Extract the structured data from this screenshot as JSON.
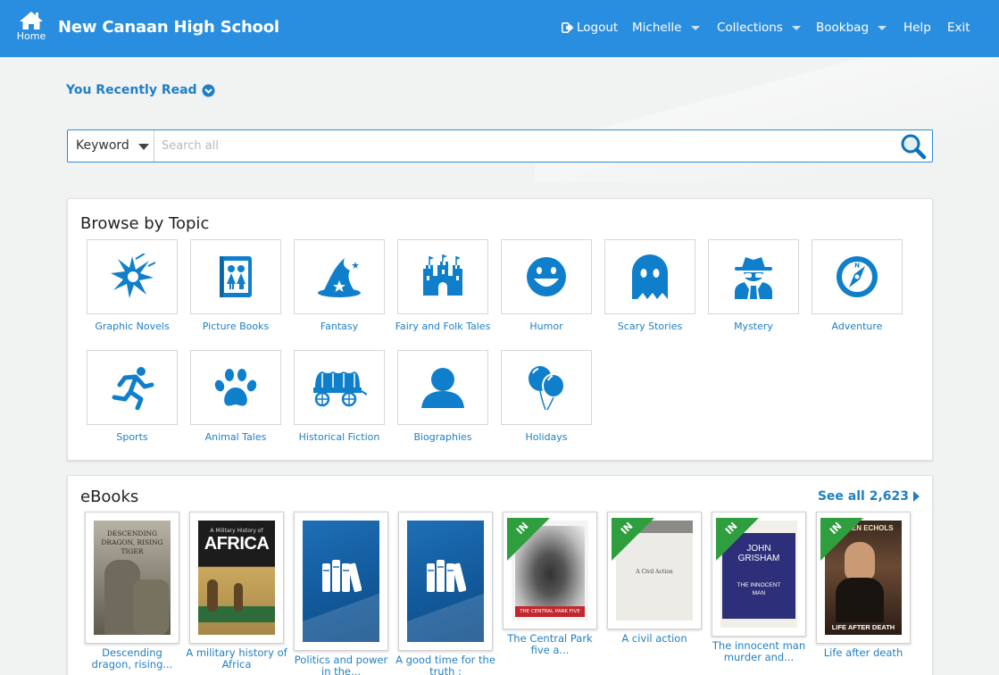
{
  "header": {
    "home_label": "Home",
    "school_name": "New Canaan High School",
    "logout": "Logout",
    "user": "Michelle",
    "collections": "Collections",
    "bookbag": "Bookbag",
    "help": "Help",
    "exit": "Exit"
  },
  "recent": {
    "label": "You Recently Read"
  },
  "search": {
    "type": "Keyword",
    "placeholder": "Search all"
  },
  "browse": {
    "title": "Browse by Topic",
    "topics": [
      {
        "label": "Graphic Novels",
        "icon": "burst-icon"
      },
      {
        "label": "Picture Books",
        "icon": "picture-book-icon"
      },
      {
        "label": "Fantasy",
        "icon": "wizard-hat-icon"
      },
      {
        "label": "Fairy and Folk Tales",
        "icon": "castle-icon"
      },
      {
        "label": "Humor",
        "icon": "smiley-icon"
      },
      {
        "label": "Scary Stories",
        "icon": "ghost-icon"
      },
      {
        "label": "Mystery",
        "icon": "detective-icon"
      },
      {
        "label": "Adventure",
        "icon": "compass-icon"
      },
      {
        "label": "Sports",
        "icon": "runner-icon"
      },
      {
        "label": "Animal Tales",
        "icon": "paw-icon"
      },
      {
        "label": "Historical Fiction",
        "icon": "covered-wagon-icon"
      },
      {
        "label": "Biographies",
        "icon": "person-icon"
      },
      {
        "label": "Holidays",
        "icon": "balloons-icon"
      }
    ]
  },
  "ebooks": {
    "title": "eBooks",
    "see_all": "See all 2,623",
    "badge": "IN",
    "books": [
      {
        "title": "Descending dragon, rising...",
        "cover_text": "DESCENDING DRAGON, RISING TIGER"
      },
      {
        "title": "A military history of Africa",
        "cover_text": "AFRICA",
        "cover_subtext": "A Military History of"
      },
      {
        "title": "Politics and power in the..."
      },
      {
        "title": "A good time for the truth :"
      },
      {
        "title": "The Central Park five a...",
        "cover_text": "THE CENTRAL PARK FIVE"
      },
      {
        "title": "A civil action",
        "cover_text": "A Civil Action"
      },
      {
        "title": "The innocent man murder and...",
        "cover_text": "JOHN GRISHAM",
        "cover_subtext": "THE INNOCENT MAN"
      },
      {
        "title": "Life after death",
        "cover_text": "LIFE AFTER DEATH",
        "cover_subtext": "DAMIEN ECHOLS"
      }
    ]
  },
  "colors": {
    "brand": "#2a8ee0",
    "accent": "#1f7fc6",
    "icon": "#0f7fcc",
    "badge": "#2f9e3f"
  }
}
